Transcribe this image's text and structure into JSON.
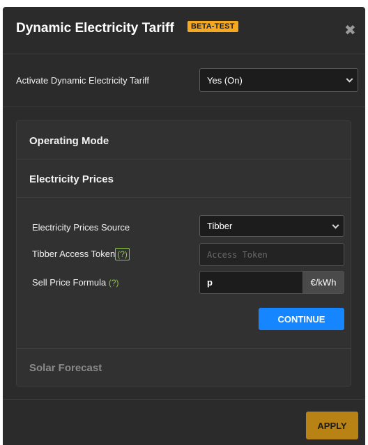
{
  "header": {
    "title": "Dynamic Electricity Tariff",
    "badge": "BETA-TEST",
    "close_icon": "close-icon"
  },
  "activate": {
    "label": "Activate Dynamic Electricity Tariff",
    "value": "Yes (On)"
  },
  "sections": {
    "operating_mode": "Operating Mode",
    "electricity_prices": "Electricity Prices",
    "solar_forecast": "Solar Forecast"
  },
  "prices_form": {
    "source_label": "Electricity Prices Source",
    "source_value": "Tibber",
    "token_label": "Tibber Access Token",
    "token_help": "(?)",
    "token_placeholder": "Access Token",
    "formula_label": "Sell Price Formula",
    "formula_help": "(?)",
    "formula_value": "p",
    "formula_unit": "€/kWh",
    "continue_label": "CONTINUE"
  },
  "footer": {
    "apply_label": "APPLY"
  },
  "colors": {
    "badge": "#f6a821",
    "help": "#8cc63f",
    "continue": "#1586ff",
    "apply": "#b88314"
  }
}
